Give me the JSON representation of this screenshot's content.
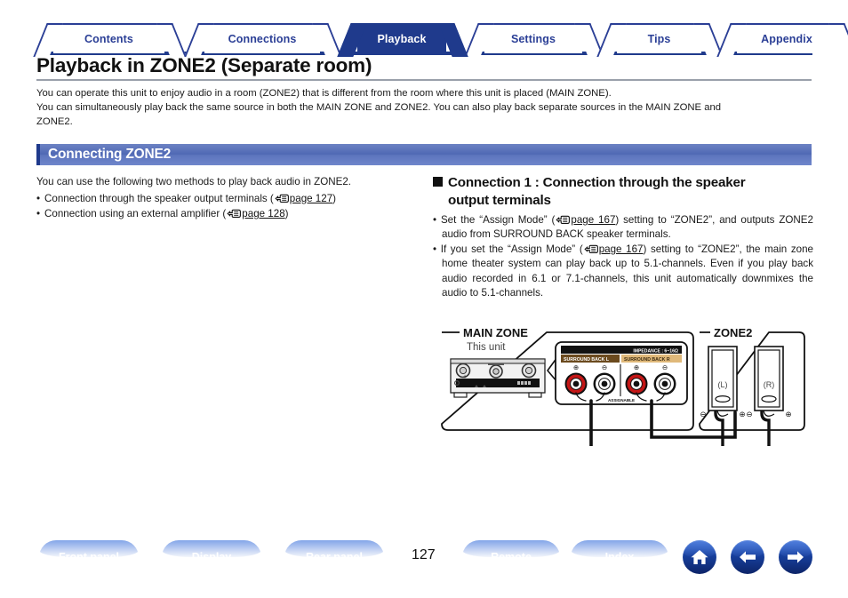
{
  "tabs": [
    {
      "label": "Contents",
      "active": false
    },
    {
      "label": "Connections",
      "active": false
    },
    {
      "label": "Playback",
      "active": true
    },
    {
      "label": "Settings",
      "active": false
    },
    {
      "label": "Tips",
      "active": false
    },
    {
      "label": "Appendix",
      "active": false
    }
  ],
  "header": {
    "title": "Playback in ZONE2 (Separate room)"
  },
  "intro": {
    "line1": "You can operate this unit to enjoy audio in a room (ZONE2) that is different from the room where this unit is placed (MAIN ZONE).",
    "line2": "You can simultaneously play back the same source in both the MAIN ZONE and ZONE2. You can also play back separate sources in the MAIN ZONE and",
    "line3": "ZONE2."
  },
  "section": {
    "title": "Connecting ZONE2"
  },
  "left_column": {
    "lead": "You can use the following two methods to play back audio in ZONE2.",
    "bullets": [
      {
        "text_before": "Connection through the speaker output terminals (",
        "ref": "page 127",
        "text_after": ")"
      },
      {
        "text_before": "Connection using an external amplifier (",
        "ref": "page 128",
        "text_after": ")"
      }
    ]
  },
  "right_column": {
    "heading_line1": "Connection 1 : Connection through the speaker",
    "heading_line2": "output terminals",
    "bullets": [
      {
        "part1": "Set the “Assign Mode” (",
        "ref": "page 167",
        "part2": ") setting to “ZONE2”, and outputs ZONE2 audio from SURROUND BACK speaker terminals."
      },
      {
        "part1": "If you set the “Assign Mode” (",
        "ref": "page 167",
        "part2": ") setting to “ZONE2”, the main zone home theater system can play back up to 5.1-channels. Even if you play back audio recorded in 6.1 or 7.1-channels, this unit automatically downmixes the audio to 5.1-channels."
      }
    ]
  },
  "diagram": {
    "main_zone_label": "MAIN ZONE",
    "zone2_label": "ZONE2",
    "unit_label": "This unit",
    "panel": {
      "impedance": "IMPEDANCE : 6~16Ω",
      "terminal_left_label": "SURROUND BACK L",
      "terminal_right_label": "SURROUND BACK R",
      "assignable": "ASSIGNABLE",
      "plus_symbol": "⊕",
      "minus_symbol": "⊖"
    },
    "speakers": [
      {
        "label": "(L)",
        "minus": "⊖",
        "plus": "⊕"
      },
      {
        "label": "(R)",
        "minus": "⊖",
        "plus": "⊕"
      }
    ]
  },
  "bottom_nav": {
    "buttons": [
      {
        "label": "Front panel"
      },
      {
        "label": "Display"
      },
      {
        "label": "Rear panel"
      },
      {
        "label": "Remote"
      },
      {
        "label": "Index"
      }
    ],
    "page_number": "127",
    "icons": [
      {
        "name": "home-icon"
      },
      {
        "name": "arrow-left-icon"
      },
      {
        "name": "arrow-right-icon"
      }
    ]
  },
  "colors": {
    "accent_navy": "#1f3a8c",
    "tab_text": "#2b3f96",
    "section_bar": "#5c74bd",
    "terminal_red": "#cc1111",
    "panel_dark": "#6b4a1e",
    "panel_light": "#e0b97a"
  }
}
